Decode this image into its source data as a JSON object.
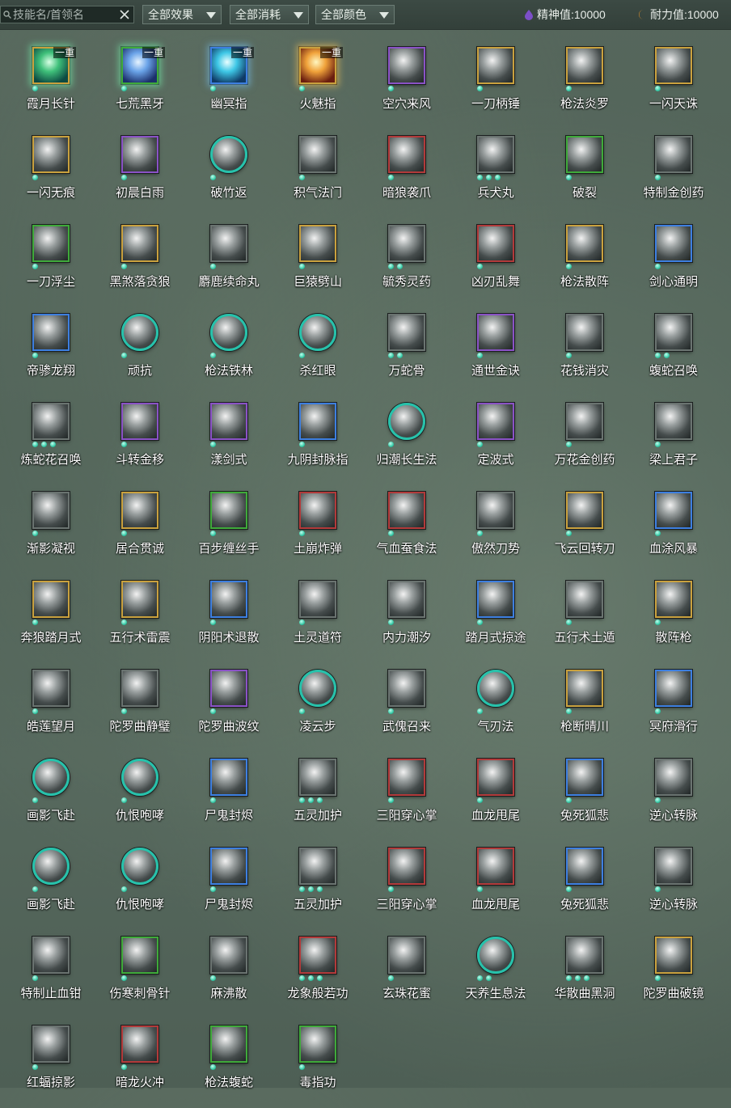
{
  "topbar": {
    "search_placeholder": "技能名/首领名",
    "filters": [
      "全部效果",
      "全部消耗",
      "全部颜色"
    ],
    "spirit_label": "精神值:10000",
    "stamina_label": "耐力值:10000"
  },
  "skills": [
    {
      "name": "霞月长针",
      "frame": "gold",
      "art": "c0",
      "glow": "glow",
      "badge": "一重",
      "dots": 1
    },
    {
      "name": "七荒黑牙",
      "frame": "green",
      "art": "c1",
      "glow": "glow",
      "badge": "一重",
      "dots": 1
    },
    {
      "name": "幽冥指",
      "frame": "blue",
      "art": "c2",
      "glow": "glow2",
      "badge": "一重",
      "dots": 1
    },
    {
      "name": "火魅指",
      "frame": "gold",
      "art": "c3",
      "glow": "glow3",
      "badge": "一重",
      "dots": 1
    },
    {
      "name": "空穴来风",
      "frame": "purple",
      "dots": 1
    },
    {
      "name": "一刀柄锤",
      "frame": "gold",
      "dots": 1
    },
    {
      "name": "枪法炎罗",
      "frame": "gold",
      "dots": 1
    },
    {
      "name": "一闪天诛",
      "frame": "gold",
      "dots": 1
    },
    {
      "name": "一闪无痕",
      "frame": "gold",
      "dots": 1
    },
    {
      "name": "初晨白雨",
      "frame": "purple",
      "dots": 1
    },
    {
      "name": "破竹返",
      "frame": "round",
      "dots": 1
    },
    {
      "name": "积气法门",
      "frame": "gray",
      "dots": 1
    },
    {
      "name": "暗狼袭爪",
      "frame": "red",
      "dots": 1
    },
    {
      "name": "兵犬丸",
      "frame": "gray",
      "dots": 3
    },
    {
      "name": "破裂",
      "frame": "green",
      "dots": 1
    },
    {
      "name": "特制金创药",
      "frame": "gray",
      "dots": 1
    },
    {
      "name": "一刀浮尘",
      "frame": "green",
      "dots": 1
    },
    {
      "name": "黑煞落贪狼",
      "frame": "gold",
      "dots": 1
    },
    {
      "name": "麝鹿续命丸",
      "frame": "gray",
      "dots": 1
    },
    {
      "name": "巨猿劈山",
      "frame": "gold",
      "dots": 1
    },
    {
      "name": "毓秀灵药",
      "frame": "gray",
      "dots": 2
    },
    {
      "name": "凶刃乱舞",
      "frame": "red",
      "dots": 1
    },
    {
      "name": "枪法散阵",
      "frame": "gold",
      "dots": 1
    },
    {
      "name": "剑心通明",
      "frame": "blue",
      "dots": 1
    },
    {
      "name": "帝骖龙翔",
      "frame": "blue",
      "dots": 1
    },
    {
      "name": "顽抗",
      "frame": "round",
      "dots": 1
    },
    {
      "name": "枪法铁林",
      "frame": "round",
      "dots": 1
    },
    {
      "name": "杀红眼",
      "frame": "round",
      "dots": 1
    },
    {
      "name": "万蛇骨",
      "frame": "gray",
      "dots": 2
    },
    {
      "name": "通世金诀",
      "frame": "purple",
      "dots": 1
    },
    {
      "name": "花钱消灾",
      "frame": "gray",
      "dots": 1
    },
    {
      "name": "蝮蛇召唤",
      "frame": "gray",
      "dots": 2
    },
    {
      "name": "炼蛇花召唤",
      "frame": "gray",
      "dots": 3
    },
    {
      "name": "斗转金移",
      "frame": "purple",
      "dots": 1
    },
    {
      "name": "漾剑式",
      "frame": "purple",
      "dots": 1
    },
    {
      "name": "九阴封脉指",
      "frame": "blue",
      "dots": 1
    },
    {
      "name": "归潮长生法",
      "frame": "round",
      "dots": 1
    },
    {
      "name": "定波式",
      "frame": "purple",
      "dots": 1
    },
    {
      "name": "万花金创药",
      "frame": "gray",
      "dots": 1
    },
    {
      "name": "梁上君子",
      "frame": "gray",
      "dots": 1
    },
    {
      "name": "渐影凝视",
      "frame": "gray",
      "dots": 1
    },
    {
      "name": "居合贯诚",
      "frame": "gold",
      "dots": 1
    },
    {
      "name": "百步缠丝手",
      "frame": "green",
      "dots": 1
    },
    {
      "name": "土崩炸弹",
      "frame": "red",
      "dots": 1
    },
    {
      "name": "气血蚕食法",
      "frame": "red",
      "dots": 1
    },
    {
      "name": "傲然刀势",
      "frame": "gray",
      "dots": 1
    },
    {
      "name": "飞云回转刀",
      "frame": "gold",
      "dots": 1
    },
    {
      "name": "血涂风暴",
      "frame": "blue",
      "dots": 1
    },
    {
      "name": "奔狼踏月式",
      "frame": "gold",
      "dots": 1
    },
    {
      "name": "五行术雷震",
      "frame": "gold",
      "dots": 1
    },
    {
      "name": "阴阳术退散",
      "frame": "blue",
      "dots": 1
    },
    {
      "name": "土灵道符",
      "frame": "gray",
      "dots": 1
    },
    {
      "name": "内力潮汐",
      "frame": "gray",
      "dots": 1
    },
    {
      "name": "踏月式掠途",
      "frame": "blue",
      "dots": 1
    },
    {
      "name": "五行术土遁",
      "frame": "gray",
      "dots": 1
    },
    {
      "name": "散阵枪",
      "frame": "gold",
      "dots": 1
    },
    {
      "name": "皓莲望月",
      "frame": "gray",
      "dots": 1
    },
    {
      "name": "陀罗曲静璧",
      "frame": "gray",
      "dots": 1
    },
    {
      "name": "陀罗曲波纹",
      "frame": "purple",
      "dots": 1
    },
    {
      "name": "凌云步",
      "frame": "round",
      "dots": 1
    },
    {
      "name": "武傀召来",
      "frame": "gray",
      "dots": 1
    },
    {
      "name": "气刃法",
      "frame": "round",
      "dots": 1
    },
    {
      "name": "枪断晴川",
      "frame": "gold",
      "dots": 1
    },
    {
      "name": "冥府滑行",
      "frame": "blue",
      "dots": 1
    },
    {
      "name": "画影飞赴",
      "frame": "round",
      "dots": 1
    },
    {
      "name": "仇恨咆哮",
      "frame": "round",
      "dots": 1
    },
    {
      "name": "尸鬼封烬",
      "frame": "blue",
      "dots": 1
    },
    {
      "name": "五灵加护",
      "frame": "gray",
      "dots": 3
    },
    {
      "name": "三阳穿心掌",
      "frame": "red",
      "dots": 1
    },
    {
      "name": "血龙甩尾",
      "frame": "red",
      "dots": 1
    },
    {
      "name": "兔死狐悲",
      "frame": "blue",
      "dots": 1
    },
    {
      "name": "逆心转脉",
      "frame": "gray",
      "dots": 1
    },
    {
      "name": "画影飞赴",
      "frame": "round",
      "dots": 1
    },
    {
      "name": "仇恨咆哮",
      "frame": "round",
      "dots": 1
    },
    {
      "name": "尸鬼封烬",
      "frame": "blue",
      "dots": 1
    },
    {
      "name": "五灵加护",
      "frame": "gray",
      "dots": 3
    },
    {
      "name": "三阳穿心掌",
      "frame": "red",
      "dots": 1
    },
    {
      "name": "血龙甩尾",
      "frame": "red",
      "dots": 1
    },
    {
      "name": "兔死狐悲",
      "frame": "blue",
      "dots": 1
    },
    {
      "name": "逆心转脉",
      "frame": "gray",
      "dots": 1
    },
    {
      "name": "特制止血钳",
      "frame": "gray",
      "dots": 1
    },
    {
      "name": "伤寒刺骨针",
      "frame": "green",
      "dots": 1
    },
    {
      "name": "麻沸散",
      "frame": "gray",
      "dots": 1
    },
    {
      "name": "龙象般若功",
      "frame": "red",
      "dots": 3
    },
    {
      "name": "玄珠花蜜",
      "frame": "gray",
      "dots": 1
    },
    {
      "name": "天养生息法",
      "frame": "round",
      "dots": 2
    },
    {
      "name": "华散曲黑洞",
      "frame": "gray",
      "dots": 3
    },
    {
      "name": "陀罗曲破镜",
      "frame": "gold",
      "dots": 1
    },
    {
      "name": "红蝠掠影",
      "frame": "gray",
      "dots": 1
    },
    {
      "name": "暗龙火冲",
      "frame": "red",
      "dots": 1
    },
    {
      "name": "枪法蝮蛇",
      "frame": "green",
      "dots": 1
    },
    {
      "name": "毒指功",
      "frame": "green",
      "dots": 1
    }
  ],
  "colors": {
    "gold": "#c9a13e",
    "purple": "#8a52c6",
    "teal": "#27c2ab",
    "blue": "#3d7fe0",
    "green": "#3faa3a",
    "red": "#b23a3a",
    "gray": "#6a7370"
  }
}
